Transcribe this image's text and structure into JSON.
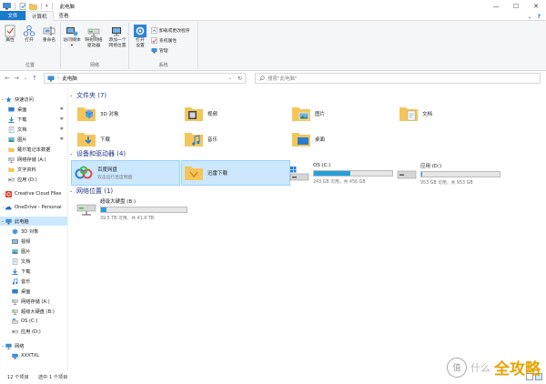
{
  "titlebar": {
    "title": "此电脑",
    "controls": {
      "minimize": "—",
      "maximize": "☐",
      "close": "✕"
    }
  },
  "ribbon_tabs": {
    "file": "文件",
    "computer": "计算机",
    "view": "查看",
    "collapse": "⌄",
    "help": "?"
  },
  "ribbon": {
    "location": {
      "label": "位置",
      "properties": "属性",
      "open": "打开",
      "rename": "重命名"
    },
    "network": {
      "label": "网络",
      "access_media": "访问媒体",
      "map_drive_line1": "映射网络",
      "map_drive_line2": "驱动器",
      "add_location_line1": "添加一个",
      "add_location_line2": "网络位置"
    },
    "system": {
      "label": "系统",
      "open_settings_line1": "打开",
      "open_settings_line2": "设置",
      "uninstall": "卸载或更改程序",
      "system_properties": "系统属性",
      "manage": "管理"
    }
  },
  "address": {
    "back": "←",
    "forward": "→",
    "dropdown": "⌄",
    "up": "↑",
    "separator": "›",
    "path": "此电脑",
    "search_placeholder": "搜索\"此电脑\""
  },
  "nav": {
    "quick_access": "快速访问",
    "items": [
      {
        "label": "桌面"
      },
      {
        "label": "下载"
      },
      {
        "label": "文档"
      },
      {
        "label": "图片"
      },
      {
        "label": "戴尔笔记本数据"
      },
      {
        "label": "网络存储 (A:)"
      },
      {
        "label": "文字资料"
      },
      {
        "label": "应用 (D:)"
      }
    ],
    "creative_cloud": "Creative Cloud Files",
    "onedrive": "OneDrive - Personal",
    "this_pc": "此电脑",
    "pc_items": [
      {
        "label": "3D 对象"
      },
      {
        "label": "视频"
      },
      {
        "label": "图片"
      },
      {
        "label": "文档"
      },
      {
        "label": "下载"
      },
      {
        "label": "音乐"
      },
      {
        "label": "桌面"
      },
      {
        "label": "网络存储 (A:)"
      },
      {
        "label": "超级大硬盘 (B:)"
      },
      {
        "label": "OS (C:)"
      },
      {
        "label": "应用 (D:)"
      }
    ],
    "network": "网络",
    "network_items": [
      {
        "label": "XXXTXL"
      }
    ]
  },
  "groups": {
    "folders": "文件夹 (7)",
    "devices": "设备和驱动器 (4)",
    "netloc": "网络位置 (1)"
  },
  "folders": [
    {
      "name": "3D 对象"
    },
    {
      "name": "视频"
    },
    {
      "name": "图片"
    },
    {
      "name": "文档"
    },
    {
      "name": "下载"
    },
    {
      "name": "音乐"
    },
    {
      "name": "桌面"
    }
  ],
  "devices": {
    "baidu": {
      "name": "百度网盘",
      "sub": "双击运行百度网盘"
    },
    "xunlei": {
      "name": "迅雷下载"
    },
    "c": {
      "name": "OS (C:)",
      "size": "243 GB 可用，共 456 GB",
      "used_fraction": 0.47
    },
    "d": {
      "name": "应用 (D:)",
      "size": "953 GB 可用，共 953 GB",
      "used_fraction": 0.01
    }
  },
  "netloc": {
    "drive": {
      "name": "超级大硬盘 (B:)",
      "size": "39.5 TB 可用，共 41.8 TB",
      "used_fraction": 0.06
    }
  },
  "status": {
    "count": "12 个项目",
    "selected": "选中 1 个项目"
  },
  "watermark": {
    "seal": "值",
    "small": "什么",
    "big": "全攻略"
  },
  "colors": {
    "accent": "#1979ca",
    "selection": "#cce8ff",
    "group_header": "#1e3287",
    "drive_bar": "#26a0da",
    "folder": "#f4c65a"
  }
}
